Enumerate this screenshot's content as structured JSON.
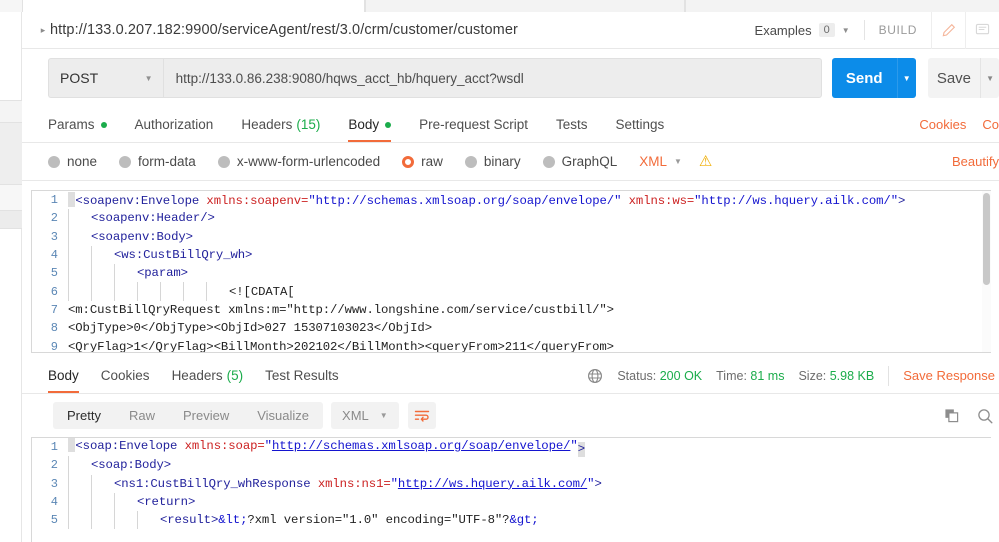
{
  "request_url_bar": {
    "caret": "▸",
    "url": "http://133.0.207.182:9900/serviceAgent/rest/3.0/crm/customer/customer",
    "examples_label": "Examples",
    "examples_count": "0",
    "build_label": "BUILD"
  },
  "send_row": {
    "method": "POST",
    "url": "http://133.0.86.238:9080/hqws_acct_hb/hquery_acct?wsdl",
    "send_label": "Send",
    "save_label": "Save"
  },
  "request_tabs": {
    "items": [
      {
        "label": "Params",
        "dot": true,
        "count": "",
        "active": false
      },
      {
        "label": "Authorization",
        "dot": false,
        "count": "",
        "active": false
      },
      {
        "label": "Headers",
        "dot": false,
        "count": "(15)",
        "active": false
      },
      {
        "label": "Body",
        "dot": true,
        "count": "",
        "active": true
      },
      {
        "label": "Pre-request Script",
        "dot": false,
        "count": "",
        "active": false
      },
      {
        "label": "Tests",
        "dot": false,
        "count": "",
        "active": false
      },
      {
        "label": "Settings",
        "dot": false,
        "count": "",
        "active": false
      }
    ],
    "cookies_label": "Cookies",
    "code_label": "Co"
  },
  "body_type_row": {
    "options": [
      {
        "label": "none",
        "selected": false
      },
      {
        "label": "form-data",
        "selected": false
      },
      {
        "label": "x-www-form-urlencoded",
        "selected": false
      },
      {
        "label": "raw",
        "selected": true
      },
      {
        "label": "binary",
        "selected": false
      },
      {
        "label": "GraphQL",
        "selected": false
      }
    ],
    "format": "XML",
    "warning_icon": "⚠",
    "beautify_label": "Beautify"
  },
  "request_body_lines": [
    {
      "n": "1",
      "indent": 0,
      "parts": [
        {
          "t": "cursor",
          "v": ""
        },
        {
          "t": "tag",
          "v": "<soapenv:Envelope "
        },
        {
          "t": "attr",
          "v": "xmlns:soapenv="
        },
        {
          "t": "val",
          "v": "\"http://schemas.xmlsoap.org/soap/envelope/\""
        },
        {
          "t": "plain",
          "v": " "
        },
        {
          "t": "attr",
          "v": "xmlns:ws="
        },
        {
          "t": "val",
          "v": "\"http://ws.hquery.ailk.com/\""
        },
        {
          "t": "tag",
          "v": ">"
        }
      ]
    },
    {
      "n": "2",
      "indent": 1,
      "parts": [
        {
          "t": "tag",
          "v": "<soapenv:Header/>"
        }
      ]
    },
    {
      "n": "3",
      "indent": 1,
      "parts": [
        {
          "t": "tag",
          "v": "<soapenv:Body>"
        }
      ]
    },
    {
      "n": "4",
      "indent": 2,
      "parts": [
        {
          "t": "tag",
          "v": "<ws:CustBillQry_wh>"
        }
      ]
    },
    {
      "n": "5",
      "indent": 3,
      "parts": [
        {
          "t": "tag",
          "v": "<param>"
        }
      ]
    },
    {
      "n": "6",
      "indent": 7,
      "parts": [
        {
          "t": "plain",
          "v": "<![CDATA["
        }
      ]
    },
    {
      "n": "7",
      "indent": 0,
      "parts": [
        {
          "t": "plain",
          "v": "<m:CustBillQryRequest xmlns:m=\"http://www.longshine.com/service/custbill/\">"
        }
      ]
    },
    {
      "n": "8",
      "indent": 0,
      "parts": [
        {
          "t": "plain",
          "v": "<ObjType>0</ObjType><ObjId>027 15307103023</ObjId>"
        }
      ]
    },
    {
      "n": "9",
      "indent": 0,
      "parts": [
        {
          "t": "plain",
          "v": "<QryFlag>1</QryFlag><BillMonth>202102</BillMonth><queryFrom>211</queryFrom>"
        }
      ]
    }
  ],
  "response_status": {
    "tabs": [
      {
        "label": "Body",
        "count": "",
        "active": true
      },
      {
        "label": "Cookies",
        "count": "",
        "active": false
      },
      {
        "label": "Headers",
        "count": "(5)",
        "active": false
      },
      {
        "label": "Test Results",
        "count": "",
        "active": false
      }
    ],
    "status_label": "Status:",
    "status_value": "200 OK",
    "time_label": "Time:",
    "time_value": "81 ms",
    "size_label": "Size:",
    "size_value": "5.98 KB",
    "save_response_label": "Save Response"
  },
  "response_toolbar": {
    "views": [
      {
        "label": "Pretty",
        "active": true
      },
      {
        "label": "Raw",
        "active": false
      },
      {
        "label": "Preview",
        "active": false
      },
      {
        "label": "Visualize",
        "active": false
      }
    ],
    "format": "XML"
  },
  "response_body_lines": [
    {
      "n": "1",
      "indent": 0,
      "parts": [
        {
          "t": "cursor",
          "v": ""
        },
        {
          "t": "tag",
          "v": "<soap:Envelope "
        },
        {
          "t": "attr",
          "v": "xmlns:soap="
        },
        {
          "t": "val",
          "v": "\""
        },
        {
          "t": "link",
          "v": "http://schemas.xmlsoap.org/soap/envelope/"
        },
        {
          "t": "val",
          "v": "\""
        },
        {
          "t": "cursor2",
          "v": ">"
        }
      ]
    },
    {
      "n": "2",
      "indent": 1,
      "parts": [
        {
          "t": "tag",
          "v": "<soap:Body>"
        }
      ]
    },
    {
      "n": "3",
      "indent": 2,
      "parts": [
        {
          "t": "tag",
          "v": "<ns1:CustBillQry_whResponse "
        },
        {
          "t": "attr",
          "v": "xmlns:ns1="
        },
        {
          "t": "val",
          "v": "\""
        },
        {
          "t": "link",
          "v": "http://ws.hquery.ailk.com/"
        },
        {
          "t": "val",
          "v": "\""
        },
        {
          "t": "tag",
          "v": ">"
        }
      ]
    },
    {
      "n": "4",
      "indent": 3,
      "parts": [
        {
          "t": "tag",
          "v": "<return>"
        }
      ]
    },
    {
      "n": "5",
      "indent": 4,
      "parts": [
        {
          "t": "tag",
          "v": "<result>"
        },
        {
          "t": "ent",
          "v": "&lt;"
        },
        {
          "t": "plain",
          "v": "?xml version=\"1.0\" encoding=\"UTF-8\"?"
        },
        {
          "t": "ent",
          "v": "&gt;"
        }
      ]
    }
  ],
  "colors": {
    "accent_orange": "#f26b3a",
    "send_blue": "#0c8ce9",
    "status_green": "#1bac4b",
    "warning_yellow": "#f0ad00"
  }
}
